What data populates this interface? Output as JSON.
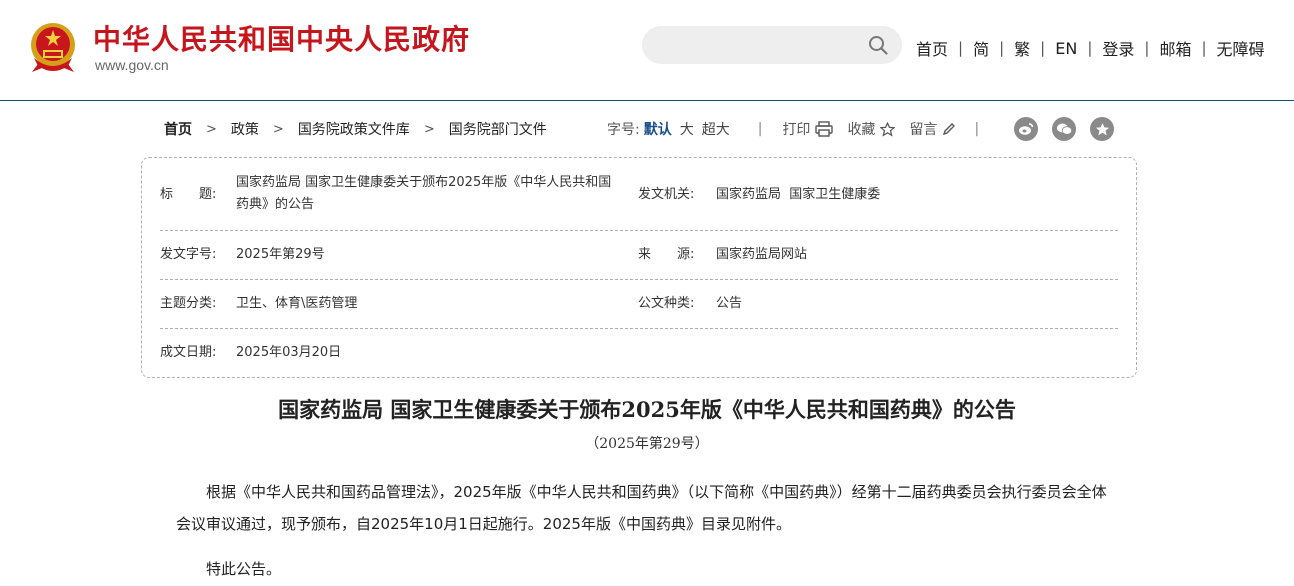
{
  "header": {
    "site_title": "中华人民共和国中央人民政府",
    "site_domain": "www.gov.cn",
    "search": {
      "placeholder": ""
    },
    "nav": [
      "首页",
      "简",
      "繁",
      "EN",
      "登录",
      "邮箱",
      "无障碍"
    ],
    "nav_separator": "|"
  },
  "breadcrumb": {
    "items": [
      "首页",
      "政策",
      "国务院政策文件库",
      "国务院部门文件"
    ],
    "separator": ">"
  },
  "toolbar": {
    "font_size_label": "字号:",
    "font_default": "默认",
    "font_large": "大",
    "font_xlarge": "超大",
    "divider": "|",
    "print": "打印",
    "favorite": "收藏",
    "comment": "留言",
    "share_icons": [
      "weibo-icon",
      "wechat-icon",
      "qzone-icon"
    ]
  },
  "info": {
    "title_label": "标　　题:",
    "title_value_line1": "国家药监局 国家卫生健康委关于颁布2025年版《中华人民共和国",
    "title_value_line2": "药典》的公告",
    "issuer_label": "发文机关:",
    "issuer_value": "国家药监局  国家卫生健康委",
    "doc_no_label": "发文字号:",
    "doc_no_value": "2025年第29号",
    "source_label": "来　　源:",
    "source_value": "国家药监局网站",
    "topic_label": "主题分类:",
    "topic_value": "卫生、体育\\医药管理",
    "type_label": "公文种类:",
    "type_value": "公告",
    "date_label": "成文日期:",
    "date_value": "2025年03月20日"
  },
  "article": {
    "title": "国家药监局 国家卫生健康委关于颁布2025年版《中华人民共和国药典》的公告",
    "number": "（2025年第29号）",
    "paragraph1": "根据《中华人民共和国药品管理法》，2025年版《中华人民共和国药典》（以下简称《中国药典》）经第十二届药典委员会执行委员会全体会议审议通过，现予颁布，自2025年10月1日起施行。2025年版《中国药典》目录见附件。",
    "closing": "特此公告。"
  },
  "colors": {
    "brand_red": "#c4161c",
    "header_rule": "#1e4f7a",
    "font_size_active": "#1a4f8a",
    "share_icon_bg": "#8a8a8a"
  }
}
